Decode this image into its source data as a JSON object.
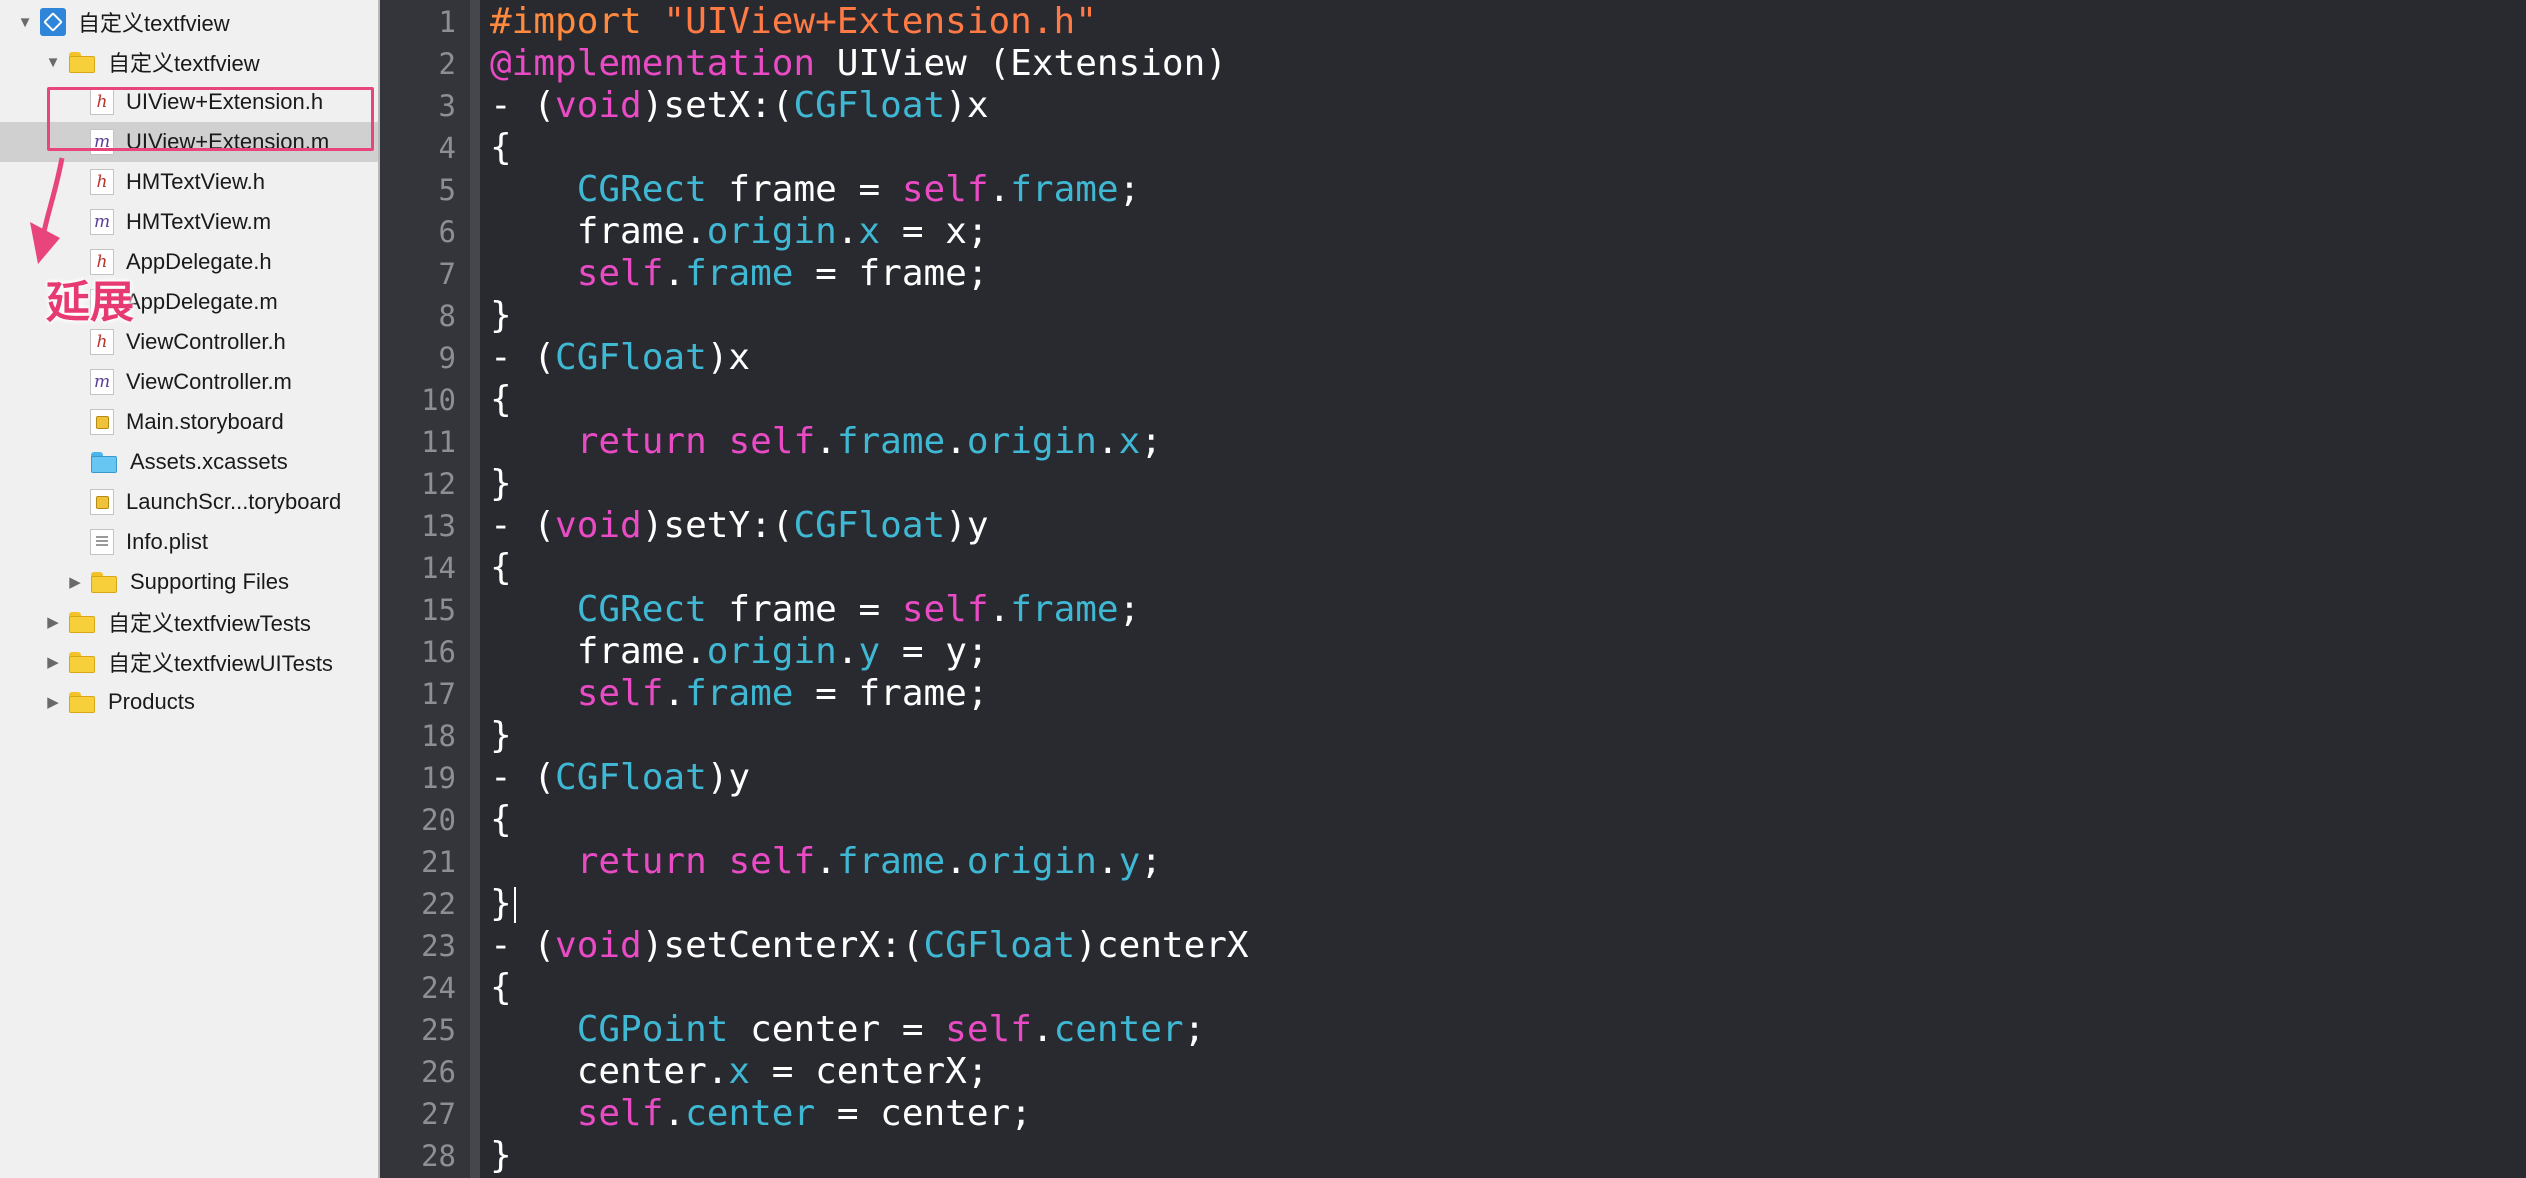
{
  "sidebar": {
    "items": [
      {
        "label": "自定义textfview",
        "icon": "xcode-project-icon",
        "icon_type": "proj",
        "disclosure": "expanded",
        "level": 0,
        "selected": false
      },
      {
        "label": "自定义textfview",
        "icon": "folder-icon",
        "icon_type": "folder",
        "disclosure": "expanded",
        "level": 1,
        "selected": false
      },
      {
        "label": "UIView+Extension.h",
        "icon": "header-file-icon",
        "icon_type": "h",
        "icon_char": "h",
        "disclosure": "none",
        "level": 2,
        "selected": false
      },
      {
        "label": "UIView+Extension.m",
        "icon": "implementation-file-icon",
        "icon_type": "m",
        "icon_char": "m",
        "disclosure": "none",
        "level": 2,
        "selected": true
      },
      {
        "label": "HMTextView.h",
        "icon": "header-file-icon",
        "icon_type": "h",
        "icon_char": "h",
        "disclosure": "none",
        "level": 2,
        "selected": false
      },
      {
        "label": "HMTextView.m",
        "icon": "implementation-file-icon",
        "icon_type": "m",
        "icon_char": "m",
        "disclosure": "none",
        "level": 2,
        "selected": false
      },
      {
        "label": "AppDelegate.h",
        "icon": "header-file-icon",
        "icon_type": "h",
        "icon_char": "h",
        "disclosure": "none",
        "level": 2,
        "selected": false
      },
      {
        "label": "AppDelegate.m",
        "icon": "implementation-file-icon",
        "icon_type": "m",
        "icon_char": "m",
        "disclosure": "none",
        "level": 2,
        "selected": false
      },
      {
        "label": "ViewController.h",
        "icon": "header-file-icon",
        "icon_type": "h",
        "icon_char": "h",
        "disclosure": "none",
        "level": 2,
        "selected": false
      },
      {
        "label": "ViewController.m",
        "icon": "implementation-file-icon",
        "icon_type": "m",
        "icon_char": "m",
        "disclosure": "none",
        "level": 2,
        "selected": false
      },
      {
        "label": "Main.storyboard",
        "icon": "storyboard-file-icon",
        "icon_type": "sb",
        "disclosure": "none",
        "level": 2,
        "selected": false
      },
      {
        "label": "Assets.xcassets",
        "icon": "asset-catalog-icon",
        "icon_type": "folder blue",
        "disclosure": "none",
        "level": 2,
        "selected": false
      },
      {
        "label": "LaunchScr...toryboard",
        "icon": "storyboard-file-icon",
        "icon_type": "sb",
        "disclosure": "none",
        "level": 2,
        "selected": false
      },
      {
        "label": "Info.plist",
        "icon": "plist-file-icon",
        "icon_type": "pl",
        "disclosure": "none",
        "level": 2,
        "selected": false
      },
      {
        "label": "Supporting Files",
        "icon": "folder-icon",
        "icon_type": "folder",
        "disclosure": "collapsed",
        "level": 2,
        "selected": false
      },
      {
        "label": "自定义textfviewTests",
        "icon": "folder-icon",
        "icon_type": "folder",
        "disclosure": "collapsed",
        "level": 1,
        "selected": false
      },
      {
        "label": "自定义textfviewUITests",
        "icon": "folder-icon",
        "icon_type": "folder",
        "disclosure": "collapsed",
        "level": 1,
        "selected": false
      },
      {
        "label": "Products",
        "icon": "folder-icon",
        "icon_type": "folder",
        "disclosure": "collapsed",
        "level": 1,
        "selected": false
      }
    ]
  },
  "annotation": {
    "label": "延展",
    "color": "#e8457c"
  },
  "editor": {
    "caret_line": 22,
    "colors": {
      "background": "#292a30",
      "keyword": "#e94bc4",
      "type": "#3fb8d4",
      "string": "#ff7a45",
      "preprocessor": "#ff8a3d",
      "plain": "#ffffff",
      "line_number": "#8d8f96"
    },
    "lines": [
      [
        [
          "pp",
          "#import "
        ],
        [
          "str",
          "\"UIView+Extension.h\""
        ]
      ],
      [
        [
          "kw",
          "@implementation"
        ],
        [
          "pl2",
          " UIView (Extension)"
        ]
      ],
      [
        [
          "pl2",
          "- ("
        ],
        [
          "kw",
          "void"
        ],
        [
          "pl2",
          ")setX:("
        ],
        [
          "ty",
          "CGFloat"
        ],
        [
          "pl2",
          ")x"
        ]
      ],
      [
        [
          "pl2",
          "{"
        ]
      ],
      [
        [
          "pl2",
          "    "
        ],
        [
          "ty",
          "CGRect"
        ],
        [
          "pl2",
          " frame = "
        ],
        [
          "kw",
          "self"
        ],
        [
          "pl2",
          "."
        ],
        [
          "ty",
          "frame"
        ],
        [
          "pl2",
          ";"
        ]
      ],
      [
        [
          "pl2",
          "    frame."
        ],
        [
          "ty",
          "origin"
        ],
        [
          "pl2",
          "."
        ],
        [
          "ty",
          "x"
        ],
        [
          "pl2",
          " = x;"
        ]
      ],
      [
        [
          "pl2",
          "    "
        ],
        [
          "kw",
          "self"
        ],
        [
          "pl2",
          "."
        ],
        [
          "ty",
          "frame"
        ],
        [
          "pl2",
          " = frame;"
        ]
      ],
      [
        [
          "pl2",
          "}"
        ]
      ],
      [
        [
          "pl2",
          "- ("
        ],
        [
          "ty",
          "CGFloat"
        ],
        [
          "pl2",
          ")x"
        ]
      ],
      [
        [
          "pl2",
          "{"
        ]
      ],
      [
        [
          "pl2",
          "    "
        ],
        [
          "kw",
          "return"
        ],
        [
          "pl2",
          " "
        ],
        [
          "kw",
          "self"
        ],
        [
          "pl2",
          "."
        ],
        [
          "ty",
          "frame"
        ],
        [
          "pl2",
          "."
        ],
        [
          "ty",
          "origin"
        ],
        [
          "pl2",
          "."
        ],
        [
          "ty",
          "x"
        ],
        [
          "pl2",
          ";"
        ]
      ],
      [
        [
          "pl2",
          "}"
        ]
      ],
      [
        [
          "pl2",
          "- ("
        ],
        [
          "kw",
          "void"
        ],
        [
          "pl2",
          ")setY:("
        ],
        [
          "ty",
          "CGFloat"
        ],
        [
          "pl2",
          ")y"
        ]
      ],
      [
        [
          "pl2",
          "{"
        ]
      ],
      [
        [
          "pl2",
          "    "
        ],
        [
          "ty",
          "CGRect"
        ],
        [
          "pl2",
          " frame = "
        ],
        [
          "kw",
          "self"
        ],
        [
          "pl2",
          "."
        ],
        [
          "ty",
          "frame"
        ],
        [
          "pl2",
          ";"
        ]
      ],
      [
        [
          "pl2",
          "    frame."
        ],
        [
          "ty",
          "origin"
        ],
        [
          "pl2",
          "."
        ],
        [
          "ty",
          "y"
        ],
        [
          "pl2",
          " = y;"
        ]
      ],
      [
        [
          "pl2",
          "    "
        ],
        [
          "kw",
          "self"
        ],
        [
          "pl2",
          "."
        ],
        [
          "ty",
          "frame"
        ],
        [
          "pl2",
          " = frame;"
        ]
      ],
      [
        [
          "pl2",
          "}"
        ]
      ],
      [
        [
          "pl2",
          "- ("
        ],
        [
          "ty",
          "CGFloat"
        ],
        [
          "pl2",
          ")y"
        ]
      ],
      [
        [
          "pl2",
          "{"
        ]
      ],
      [
        [
          "pl2",
          "    "
        ],
        [
          "kw",
          "return"
        ],
        [
          "pl2",
          " "
        ],
        [
          "kw",
          "self"
        ],
        [
          "pl2",
          "."
        ],
        [
          "ty",
          "frame"
        ],
        [
          "pl2",
          "."
        ],
        [
          "ty",
          "origin"
        ],
        [
          "pl2",
          "."
        ],
        [
          "ty",
          "y"
        ],
        [
          "pl2",
          ";"
        ]
      ],
      [
        [
          "pl2",
          "}"
        ]
      ],
      [
        [
          "pl2",
          "- ("
        ],
        [
          "kw",
          "void"
        ],
        [
          "pl2",
          ")setCenterX:("
        ],
        [
          "ty",
          "CGFloat"
        ],
        [
          "pl2",
          ")centerX"
        ]
      ],
      [
        [
          "pl2",
          "{"
        ]
      ],
      [
        [
          "pl2",
          "    "
        ],
        [
          "ty",
          "CGPoint"
        ],
        [
          "pl2",
          " center = "
        ],
        [
          "kw",
          "self"
        ],
        [
          "pl2",
          "."
        ],
        [
          "ty",
          "center"
        ],
        [
          "pl2",
          ";"
        ]
      ],
      [
        [
          "pl2",
          "    center."
        ],
        [
          "ty",
          "x"
        ],
        [
          "pl2",
          " = centerX;"
        ]
      ],
      [
        [
          "pl2",
          "    "
        ],
        [
          "kw",
          "self"
        ],
        [
          "pl2",
          "."
        ],
        [
          "ty",
          "center"
        ],
        [
          "pl2",
          " = center;"
        ]
      ],
      [
        [
          "pl2",
          "}"
        ]
      ]
    ]
  }
}
